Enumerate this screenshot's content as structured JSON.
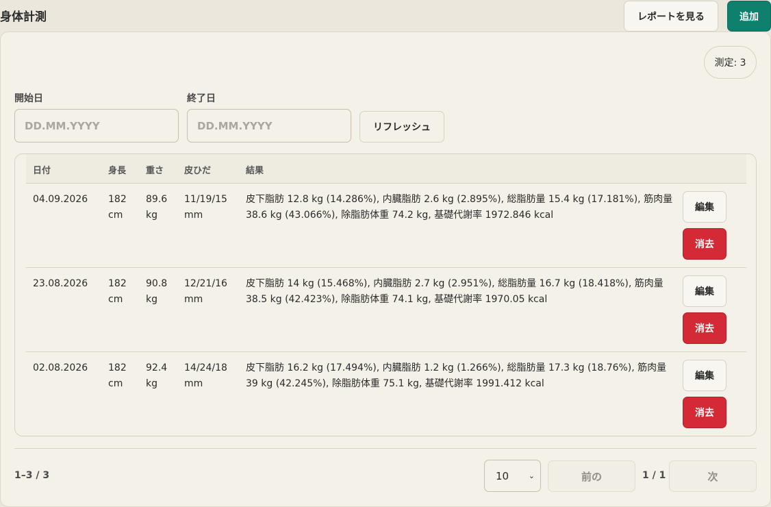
{
  "header": {
    "title": "身体計測",
    "report_label": "レポートを見る",
    "add_label": "追加"
  },
  "count_badge": "測定: 3",
  "filters": {
    "start_label": "開始日",
    "end_label": "終了日",
    "start_placeholder": "DD.MM.YYYY",
    "end_placeholder": "DD.MM.YYYY",
    "refresh_label": "リフレッシュ"
  },
  "table": {
    "headers": [
      "日付",
      "身長",
      "重さ",
      "皮ひだ",
      "結果"
    ],
    "edit_label": "編集",
    "delete_label": "消去",
    "rows": [
      {
        "date": "04.09.2026",
        "height": "182 cm",
        "weight": "89.6 kg",
        "skinfold": "11/19/15 mm",
        "result": "皮下脂肪 12.8 kg (14.286%), 内臓脂肪 2.6 kg (2.895%), 総脂肪量 15.4 kg (17.181%), 筋肉量 38.6 kg (43.066%), 除脂肪体重 74.2 kg, 基礎代謝率 1972.846 kcal"
      },
      {
        "date": "23.08.2026",
        "height": "182 cm",
        "weight": "90.8 kg",
        "skinfold": "12/21/16 mm",
        "result": "皮下脂肪 14 kg (15.468%), 内臓脂肪 2.7 kg (2.951%), 総脂肪量 16.7 kg (18.418%), 筋肉量 38.5 kg (42.423%), 除脂肪体重 74.1 kg, 基礎代謝率 1970.05 kcal"
      },
      {
        "date": "02.08.2026",
        "height": "182 cm",
        "weight": "92.4 kg",
        "skinfold": "14/24/18 mm",
        "result": "皮下脂肪 16.2 kg (17.494%), 内臓脂肪 1.2 kg (1.266%), 総脂肪量 17.3 kg (18.76%), 筋肉量 39 kg (42.245%), 除脂肪体重 75.1 kg, 基礎代謝率 1991.412 kcal"
      }
    ]
  },
  "pagination": {
    "range": "1–3 / 3",
    "page_size": "10",
    "prev_label": "前の",
    "page_indicator": "1 / 1",
    "next_label": "次"
  },
  "colors": {
    "accent": "#0f7f6e",
    "danger": "#d42a35",
    "background": "#ebe7dd",
    "card": "#f4f1e8"
  }
}
